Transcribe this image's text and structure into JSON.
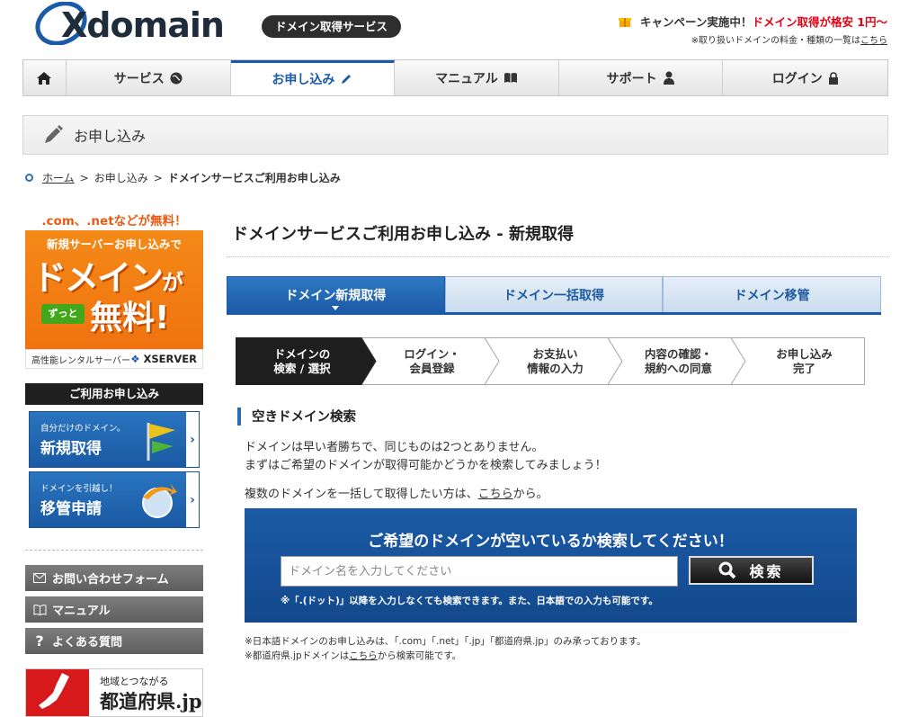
{
  "header": {
    "logo_text": "Xdomain",
    "service_badge": "ドメイン取得サービス",
    "campaign_prefix": "キャンペーン実施中！",
    "campaign_highlight": "ドメイン取得が格安 1円～",
    "note_text": "※取り扱いドメインの料金・種類の一覧は",
    "note_link": "こちら"
  },
  "nav": {
    "items": [
      {
        "label": "サービス",
        "icon": "globe-icon"
      },
      {
        "label": "お申し込み",
        "icon": "pencil-icon",
        "active": true
      },
      {
        "label": "マニュアル",
        "icon": "book-icon"
      },
      {
        "label": "サポート",
        "icon": "person-icon"
      },
      {
        "label": "ログイン",
        "icon": "lock-icon"
      }
    ]
  },
  "page_title": "お申し込み",
  "breadcrumb": {
    "home": "ホーム",
    "sep": ">",
    "level1": "お申し込み",
    "current": "ドメインサービスご利用お申し込み"
  },
  "sidebar": {
    "promo_head": ".com、.netなどが無料！",
    "promo_line1": "新規サーバーお申し込みで",
    "promo_big1": "ドメイン",
    "promo_big1_suffix": "が",
    "promo_zutto": "ずっと",
    "promo_big2": "無料!",
    "promo_footer_left": "高性能レンタルサーバー",
    "promo_footer_brand": "XSERVER",
    "apply_head": "ご利用お申し込み",
    "card_new_small": "自分だけのドメイン。",
    "card_new_big": "新規取得",
    "card_transfer_small": "ドメインを引越し！",
    "card_transfer_big": "移管申請",
    "links": [
      "お問い合わせフォーム",
      "マニュアル",
      "よくある質問"
    ],
    "pref_small": "地域とつながる",
    "pref_big": "都道府県.jp"
  },
  "main": {
    "title": "ドメインサービスご利用お申し込み - 新規取得",
    "tabs": [
      "ドメイン新規取得",
      "ドメイン一括取得",
      "ドメイン移管"
    ],
    "steps": [
      {
        "line1": "ドメインの",
        "line2": "検索 / 選択"
      },
      {
        "line1": "ログイン・",
        "line2": "会員登録"
      },
      {
        "line1": "お支払い",
        "line2": "情報の入力"
      },
      {
        "line1": "内容の確認・",
        "line2": "規約への同意"
      },
      {
        "line1": "お申し込み",
        "line2": "完了"
      }
    ],
    "section_title": "空きドメイン検索",
    "para1": "ドメインは早い者勝ちで、同じものは2つとありません。",
    "para2": "まずはご希望のドメインが取得可能かどうかを検索してみましょう！",
    "para3_prefix": "複数のドメインを一括して取得したい方は、",
    "para3_link": "こちら",
    "para3_suffix": "から。",
    "search_heading": "ご希望のドメインが空いているか検索してください！",
    "search_placeholder": "ドメイン名を入力してください",
    "search_button": "検索",
    "search_hint": "※「.(ドット)」以降を入力しなくても検索できます。また、日本語での入力も可能です。",
    "foot1": "※日本語ドメインのお申し込みは、「.com」「.net」「.jp」「都道府県.jp」のみ承っております。",
    "foot2_prefix": "※都道府県.jpドメインは",
    "foot2_link": "こちら",
    "foot2_suffix": "から検索可能です。"
  },
  "colors": {
    "brand_blue": "#1b5aa6",
    "campaign_red": "#e50012",
    "promo_orange": "#f07a14"
  }
}
